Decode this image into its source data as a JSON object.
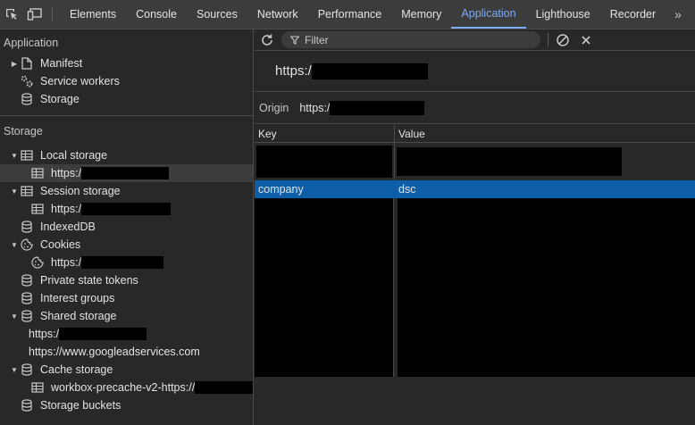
{
  "devtools": {
    "tabs": [
      "Elements",
      "Console",
      "Sources",
      "Network",
      "Performance",
      "Memory",
      "Application",
      "Lighthouse",
      "Recorder"
    ],
    "active_tab": "Application",
    "more_tabs": "»"
  },
  "sidebar": {
    "application_header": "Application",
    "application_items": [
      {
        "label": "Manifest",
        "icon": "file-icon",
        "expandable": true
      },
      {
        "label": "Service workers",
        "icon": "gears-icon",
        "expandable": false
      },
      {
        "label": "Storage",
        "icon": "database-icon",
        "expandable": false
      }
    ],
    "storage_header": "Storage",
    "local_storage": {
      "label": "Local storage",
      "child": "https:/"
    },
    "session_storage": {
      "label": "Session storage",
      "child": "https:/"
    },
    "indexeddb": "IndexedDB",
    "cookies": {
      "label": "Cookies",
      "child": "https:/"
    },
    "private_state_tokens": "Private state tokens",
    "interest_groups": "Interest groups",
    "shared_storage": {
      "label": "Shared storage",
      "children": [
        "https:/",
        "https://www.googleadservices.com"
      ]
    },
    "cache_storage": {
      "label": "Cache storage",
      "child": "workbox-precache-v2-https://"
    },
    "storage_buckets": "Storage buckets"
  },
  "main": {
    "filter_placeholder": "Filter",
    "url_title": "https:/",
    "origin_label": "Origin",
    "origin_value": "https:/",
    "columns": {
      "key": "Key",
      "value": "Value"
    },
    "rows": [
      {
        "key": "company",
        "value": "dsc"
      }
    ]
  },
  "colors": {
    "accent": "#7cacf8",
    "selection": "#0f5fa8",
    "background": "#282828",
    "toolbar": "#3c3c3c"
  }
}
